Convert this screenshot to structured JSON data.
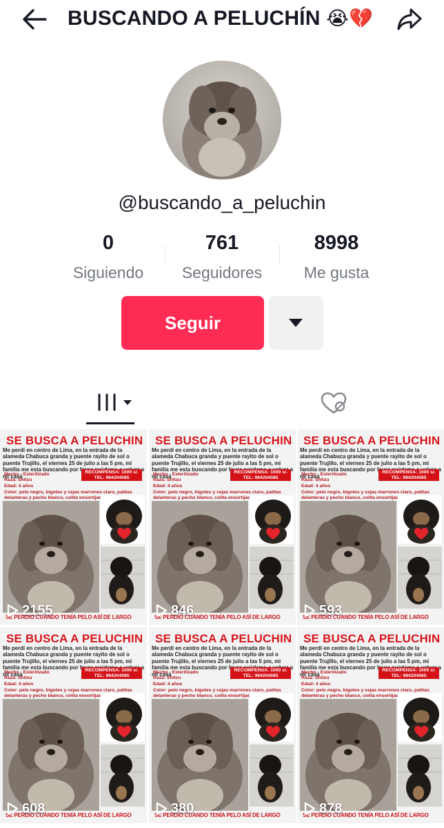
{
  "header": {
    "title": "BUSCANDO A PELUCHÍN",
    "title_emojis": "😭💔",
    "back_icon": "arrow-left-icon",
    "share_icon": "share-arrow-icon"
  },
  "profile": {
    "username": "@buscando_a_peluchin",
    "stats": [
      {
        "value": "0",
        "label": "Siguiendo"
      },
      {
        "value": "761",
        "label": "Seguidores"
      },
      {
        "value": "8998",
        "label": "Me gusta"
      }
    ],
    "follow_label": "Seguir",
    "more_icon": "caret-down-icon"
  },
  "tabs": [
    {
      "name": "videos",
      "icon": "grid-icon"
    },
    {
      "name": "liked",
      "icon": "heart-hidden-icon"
    }
  ],
  "colors": {
    "accent": "#fe2c55",
    "poster_red": "#d8141b"
  },
  "poster": {
    "title": "SE BUSCA A PELUCHIN",
    "text": "Me perdí en centro de Lima, en la entrada de la alameda Chabuca granda y puente rayito de sol o puente Trujillo, el viernes 25 de julio a las 5 pm, mi familia me esta buscando por favor ayúdame a volver a mi casa",
    "traits": "Macho - Esterilizado\nRaza: Shitzu\nEdad: 4 años",
    "reward": "RECOMPENSA: 1000 s/.\nTEL: 984204085",
    "colors_text": "Color: pelo negro, bigotes y cejas marrones claro, patitas delanteras y pecho blanco, colita ensortijada.",
    "footer": "SE PERDIÓ CUANDO TENÍA PELO ASÍ DE LARGO"
  },
  "videos": [
    {
      "views": "2155"
    },
    {
      "views": "846"
    },
    {
      "views": "593"
    },
    {
      "views": "608"
    },
    {
      "views": "380"
    },
    {
      "views": "878"
    }
  ]
}
